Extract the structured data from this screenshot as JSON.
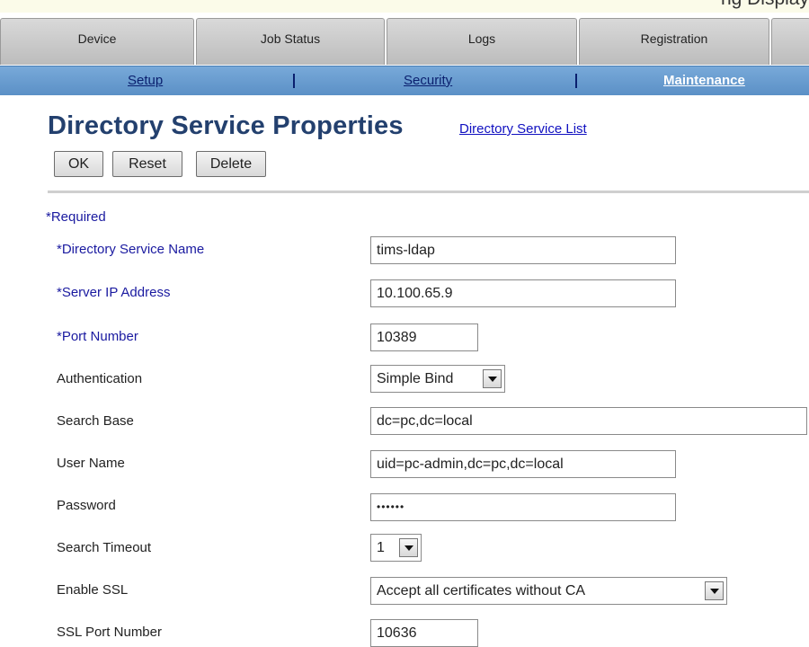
{
  "top_strip_text": "ng Display",
  "tabs": [
    "Device",
    "Job Status",
    "Logs",
    "Registration"
  ],
  "subnav": {
    "setup": "Setup",
    "security": "Security",
    "maintenance": "Maintenance"
  },
  "page": {
    "title": "Directory Service Properties",
    "list_link": "Directory Service List",
    "required_note": "*Required"
  },
  "buttons": {
    "ok": "OK",
    "reset": "Reset",
    "delete": "Delete"
  },
  "form": {
    "directory_service_name": {
      "label": "*Directory Service Name",
      "value": "tims-ldap"
    },
    "server_ip": {
      "label": "*Server IP Address",
      "value": "10.100.65.9"
    },
    "port_number": {
      "label": "*Port Number",
      "value": "10389"
    },
    "authentication": {
      "label": "Authentication",
      "value": "Simple Bind"
    },
    "search_base": {
      "label": "Search Base",
      "value": "dc=pc,dc=local"
    },
    "user_name": {
      "label": "User Name",
      "value": "uid=pc-admin,dc=pc,dc=local"
    },
    "password": {
      "label": "Password",
      "value": "••••••"
    },
    "search_timeout": {
      "label": "Search Timeout",
      "value": "1"
    },
    "enable_ssl": {
      "label": "Enable SSL",
      "value": "Accept all certificates without CA"
    },
    "ssl_port": {
      "label": "SSL Port Number",
      "value": "10636"
    }
  },
  "icons": {
    "dropdown": "chevron-down-icon"
  }
}
